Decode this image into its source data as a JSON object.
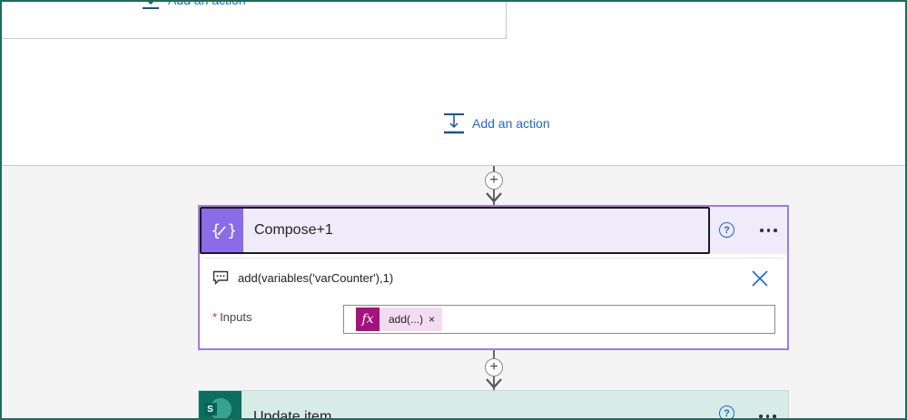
{
  "top": {
    "add_action_partial_label": "Add an action",
    "add_action_label": "Add an action"
  },
  "compose_card": {
    "title": "Compose+1",
    "icon": "compose-braces-icon",
    "help_glyph": "?",
    "comment": "add(variables('varCounter'),1)",
    "inputs_label": "Inputs",
    "required_marker": "*",
    "token_icon_label": "fx",
    "token_text": "add(...)",
    "token_remove": "×"
  },
  "update_card": {
    "title": "Update item",
    "icon_letter": "S",
    "help_glyph": "?"
  },
  "connectors": {
    "insert_glyph": "+"
  },
  "colors": {
    "accent": "#2266cc",
    "compose_purple": "#8b6ce8",
    "compose_header_bg": "#efebfb",
    "token_magenta": "#a5127e",
    "sharepoint_teal": "#0d6e5e",
    "frame_border": "#1e6b5a"
  }
}
